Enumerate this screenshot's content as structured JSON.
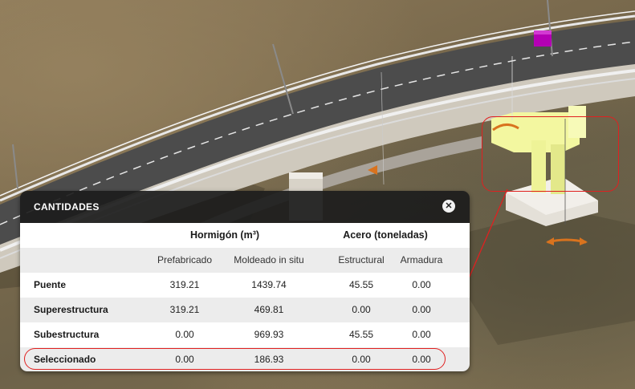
{
  "panel": {
    "title": "CANTIDADES",
    "close_symbol": "✕"
  },
  "table": {
    "group_headers": {
      "concrete": "Hormigón (m³)",
      "steel": "Acero (toneladas)"
    },
    "sub_headers": {
      "precast": "Prefabricado",
      "cast_in_place": "Moldeado in situ",
      "structural": "Estructural",
      "rebar": "Armadura"
    },
    "rows": [
      {
        "label": "Puente",
        "precast": "319.21",
        "cast_in_place": "1439.74",
        "structural": "45.55",
        "rebar": "0.00"
      },
      {
        "label": "Superestructura",
        "precast": "319.21",
        "cast_in_place": "469.81",
        "structural": "0.00",
        "rebar": "0.00"
      },
      {
        "label": "Subestructura",
        "precast": "0.00",
        "cast_in_place": "969.93",
        "structural": "45.55",
        "rebar": "0.00"
      },
      {
        "label": "Seleccionado",
        "precast": "0.00",
        "cast_in_place": "186.93",
        "structural": "0.00",
        "rebar": "0.00"
      }
    ]
  },
  "colors": {
    "highlight": "#e02020",
    "selected_pier": "#f3f7a0",
    "gizmo_arrow": "#d9731e",
    "marker": "#b400b4"
  }
}
